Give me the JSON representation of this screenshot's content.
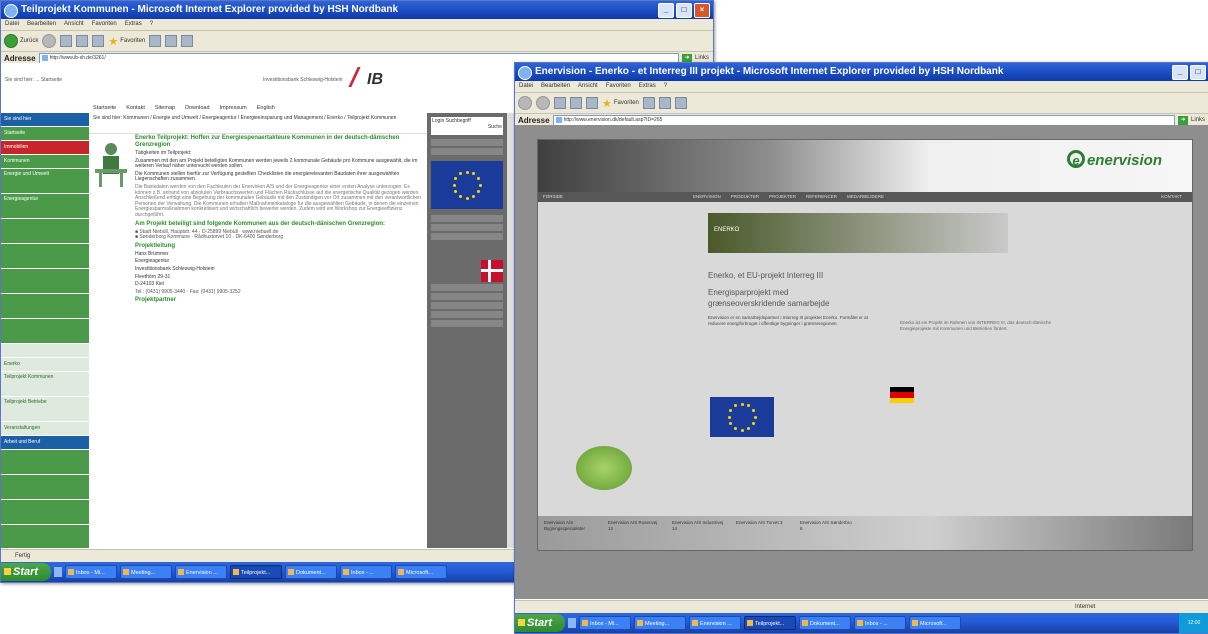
{
  "window1": {
    "title": "Teilprojekt Kommunen - Microsoft Internet Explorer provided by HSH Nordbank",
    "menu": [
      "Datei",
      "Bearbeiten",
      "Ansicht",
      "Favoriten",
      "Extras",
      "?"
    ],
    "toolbar": {
      "back": "Zurück",
      "favorites": "Favoriten"
    },
    "address_label": "Adresse",
    "address": "http://www.ib-sh.de/3261/",
    "links_label": "Links",
    "go_label": "Wechseln zu",
    "site": {
      "header_left": "Sie sind hier: ... Startseite",
      "header_mid": "Investitionsbank Schleswig-Holstein",
      "logo": "IB",
      "nav": [
        "Startseite",
        "Kontakt",
        "Sitemap",
        "Download",
        "Impressum",
        "English"
      ],
      "breadcrumb": "Sie sind hier: Kommunen / Energie und Umwelt / Energieagentur / Energieeinsparung und Management / Enerko / Teilprojekt Kommunen",
      "left_nav": [
        "Sie sind hier",
        "Startseite",
        "Immobilien",
        "Kommunen",
        "Energie und Umwelt",
        "Energieagentur",
        "Enerko",
        "Teilprojekt Kommunen",
        "Teilprojekt Betriebe",
        "Veranstaltungen",
        "Arbeit und Beruf"
      ],
      "right_search": "Login Suchbegriff",
      "right_search_btn": "Suche",
      "heading": "Enerko Teilprojekt: Hoffen zur Energiespenaertakteure Kommunen in der deutsch-dänischen Grenzregion",
      "para1_title": "Tätigkeiten im Teilprojekt:",
      "para1": "Zusammen mit den am Projekt beteiligten Kommunen werden jeweils 2 kommunale Gebäude pro Kommune ausgewählt, die im weiteren Verlauf näher untersucht werden sollen.",
      "para2": "Die Kommunen stellen hierfür zur Verfügung gestellten Checklisten die energierelevanten Baudaten ihrer ausgewählten Liegenschaften zusammen.",
      "contact_title": "Projektleitung",
      "contact": [
        "Hans Brümmer",
        "Energieagentur",
        "Investitionsbank Schleswig-Holstein",
        "Fleethörn 29-31",
        "D-24103 Kiel"
      ],
      "section_title": "Am Projekt beteiligt sind folgende Kommunen aus der deutsch-dänischen Grenzregion:",
      "partners_title": "Projektpartner"
    },
    "status": "Fertig"
  },
  "window2": {
    "title": "Enervision - Enerko - et Interreg III projekt - Microsoft Internet Explorer provided by HSH Nordbank",
    "menu": [
      "Datei",
      "Bearbeiten",
      "Ansicht",
      "Favoriten",
      "Extras",
      "?"
    ],
    "toolbar": {
      "back": "Zurück",
      "favorites": "Favoriten"
    },
    "address_label": "Adresse",
    "address": "http://www.enervision.dk/default.asp?ID=265",
    "links_label": "Links",
    "go_label": "Wechseln zu",
    "site": {
      "logo": "enervision",
      "nav": [
        "FORSIDE",
        "ENERVISION",
        "PRODUKTER",
        "PROJEKTER",
        "REFERENCER",
        "MEDARBEJDERE",
        "KONTAKT"
      ],
      "banner_text": "ENERKO",
      "title_line1": "Enerko, et EU-projekt Interreg III",
      "title_line2": "Energisparprojekt med",
      "title_line3": "grænseoverskridende samarbejde",
      "col1": "Enervision er en samarbejdspartner i Interreg III projektet Enerko. Formålet er at reducere energiforbruget i offentlige bygninger i grænseregionen.",
      "col2": "Enerko ist ein Projekt im Rahmen von INTERREG III, das deutsch-dänische Energieprojekte mit Kommunen und Betrieben fördert.",
      "footer": [
        "Enervision A/S Bygningsspecialister",
        "Enervision A/S Rosenvej 12",
        "Enervision A/S Industrivej 14",
        "Enervision A/S Torvet 3",
        "Enervision A/S Sønderbro 8"
      ]
    },
    "status": "Internet"
  },
  "taskbar": {
    "start": "Start",
    "items": [
      "Inbox - Mi...",
      "Meeting...",
      "Enervision ...",
      "Teilprojekt...",
      "Dokument...",
      "Inbox - ...",
      "Microsoft..."
    ],
    "time": "12:00"
  },
  "colors": {
    "title_blue": "#1a4cc1",
    "ib_green": "#4a9a4a",
    "ib_red": "#c8252b",
    "ev_green": "#2e7d32"
  }
}
